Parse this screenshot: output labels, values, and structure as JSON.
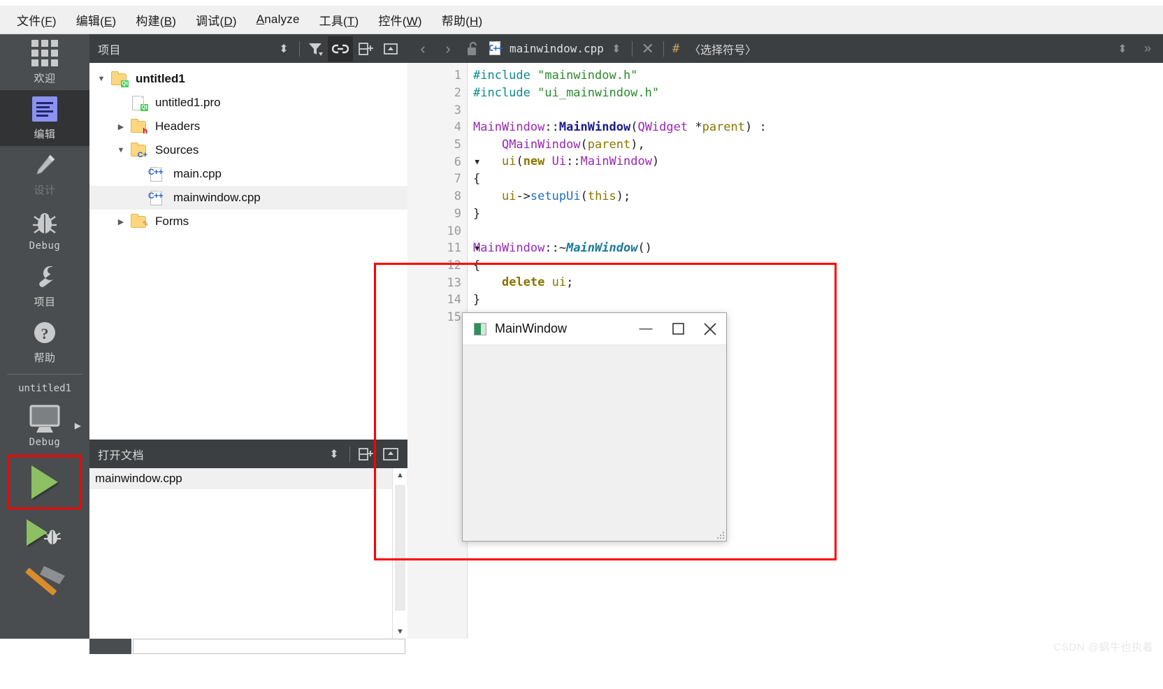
{
  "menubar": {
    "items": [
      {
        "text_before": "文件(",
        "mnemonic": "F",
        "text_after": ")",
        "full": "文件(F)"
      },
      {
        "text_before": "编辑(",
        "mnemonic": "E",
        "text_after": ")",
        "full": "编辑(E)"
      },
      {
        "text_before": "构建(",
        "mnemonic": "B",
        "text_after": ")",
        "full": "构建(B)"
      },
      {
        "text_before": "调试(",
        "mnemonic": "D",
        "text_after": ")",
        "full": "调试(D)"
      },
      {
        "text_before": "",
        "mnemonic": "A",
        "text_after": "nalyze",
        "full": "Analyze"
      },
      {
        "text_before": "工具(",
        "mnemonic": "T",
        "text_after": ")",
        "full": "工具(T)"
      },
      {
        "text_before": "控件(",
        "mnemonic": "W",
        "text_after": ")",
        "full": "控件(W)"
      },
      {
        "text_before": "帮助(",
        "mnemonic": "H",
        "text_after": ")",
        "full": "帮助(H)"
      }
    ]
  },
  "activitybar": {
    "modes": [
      {
        "label": "欢迎",
        "icon": "grid-icon",
        "state": "normal"
      },
      {
        "label": "编辑",
        "icon": "edit-icon",
        "state": "selected"
      },
      {
        "label": "设计",
        "icon": "pencil-icon",
        "state": "disabled"
      },
      {
        "label": "Debug",
        "icon": "bug-icon",
        "state": "normal"
      },
      {
        "label": "项目",
        "icon": "wrench-icon",
        "state": "normal"
      },
      {
        "label": "帮助",
        "icon": "question-icon",
        "state": "normal"
      }
    ],
    "kit": {
      "project_name": "untitled1",
      "build_config": "Debug",
      "icon": "monitor-icon",
      "expand_arrow": "▶"
    },
    "run_button": {
      "name": "run-button",
      "icon": "play-triangle",
      "highlighted": true,
      "highlight_color": "#ff0000"
    },
    "debug_button": {
      "name": "start-debugging-button",
      "icon": "play-with-bug"
    },
    "build_button": {
      "name": "build-button",
      "icon": "hammer"
    }
  },
  "project_dock": {
    "title": "项目",
    "toolbar": [
      {
        "name": "filter-configuration-button",
        "icon": "filter-icon",
        "active": false
      },
      {
        "name": "synchronize-selection-button",
        "icon": "link-icon",
        "active": true
      },
      {
        "name": "split-button",
        "icon": "split-icon",
        "active": false
      },
      {
        "name": "close-sidebar-button",
        "icon": "collapse-icon",
        "active": false
      }
    ],
    "sort_control": "⬍",
    "tree": [
      {
        "label": "untitled1",
        "indent": 0,
        "twisty": "▼",
        "icon": "qt-project-folder",
        "bold": true,
        "selected": false
      },
      {
        "label": "untitled1.pro",
        "indent": 1,
        "twisty": "",
        "icon": "qt-pro-file",
        "bold": false,
        "selected": false
      },
      {
        "label": "Headers",
        "indent": 1,
        "twisty": "▶",
        "icon": "headers-folder",
        "bold": false,
        "selected": false
      },
      {
        "label": "Sources",
        "indent": 1,
        "twisty": "▼",
        "icon": "sources-folder",
        "bold": false,
        "selected": false
      },
      {
        "label": "main.cpp",
        "indent": 2,
        "twisty": "",
        "icon": "cpp-file",
        "bold": false,
        "selected": false
      },
      {
        "label": "mainwindow.cpp",
        "indent": 2,
        "twisty": "",
        "icon": "cpp-file",
        "bold": false,
        "selected": true
      },
      {
        "label": "Forms",
        "indent": 1,
        "twisty": "▶",
        "icon": "forms-folder",
        "bold": false,
        "selected": false
      }
    ]
  },
  "opendoc_dock": {
    "title": "打开文档",
    "sort_control": "⬍",
    "toolbar": [
      {
        "name": "split-button",
        "icon": "split-icon"
      },
      {
        "name": "close-sidebar-button",
        "icon": "collapse-icon"
      }
    ],
    "documents": [
      {
        "label": "mainwindow.cpp",
        "selected": true
      }
    ]
  },
  "editor": {
    "toolbar": {
      "back_icon": "chevron-left-icon",
      "forward_icon": "chevron-right-icon",
      "lock_icon": "unlocked-padlock-icon",
      "file_icon": "cpp-file-icon",
      "filename": "mainwindow.cpp",
      "dropdown_icon": "⬍",
      "close_label": "✕",
      "hash_symbol": "#",
      "symbol_selector": "〈选择符号〉",
      "overflow_icon": "»",
      "overflow_dropdown": "⬍"
    },
    "lines": [
      {
        "num": "1",
        "fold": "",
        "tokens": [
          {
            "t": "#include ",
            "c": "k-pre"
          },
          {
            "t": "\"mainwindow.h\"",
            "c": "k-str"
          }
        ]
      },
      {
        "num": "2",
        "fold": "",
        "tokens": [
          {
            "t": "#include ",
            "c": "k-pre"
          },
          {
            "t": "\"ui_mainwindow.h\"",
            "c": "k-str"
          }
        ]
      },
      {
        "num": "3",
        "fold": "",
        "tokens": []
      },
      {
        "num": "4",
        "fold": "",
        "tokens": [
          {
            "t": "MainWindow",
            "c": "k-cls"
          },
          {
            "t": "::",
            "c": "k-op"
          },
          {
            "t": "MainWindow",
            "c": "k-fn"
          },
          {
            "t": "(",
            "c": "k-op"
          },
          {
            "t": "QWidget",
            "c": "k-cls"
          },
          {
            "t": " *",
            "c": "k-op"
          },
          {
            "t": "parent",
            "c": "k-var"
          },
          {
            "t": ") :",
            "c": "k-op"
          }
        ]
      },
      {
        "num": "5",
        "fold": "",
        "tokens": [
          {
            "t": "    ",
            "c": "k-plain"
          },
          {
            "t": "QMainWindow",
            "c": "k-cls"
          },
          {
            "t": "(",
            "c": "k-op"
          },
          {
            "t": "parent",
            "c": "k-var"
          },
          {
            "t": "),",
            "c": "k-op"
          }
        ]
      },
      {
        "num": "6",
        "fold": "▼",
        "tokens": [
          {
            "t": "    ",
            "c": "k-plain"
          },
          {
            "t": "ui",
            "c": "k-var"
          },
          {
            "t": "(",
            "c": "k-op"
          },
          {
            "t": "new ",
            "c": "k-kw"
          },
          {
            "t": "Ui",
            "c": "k-cls"
          },
          {
            "t": "::",
            "c": "k-op"
          },
          {
            "t": "MainWindow",
            "c": "k-cls"
          },
          {
            "t": ")",
            "c": "k-op"
          }
        ]
      },
      {
        "num": "7",
        "fold": "",
        "tokens": [
          {
            "t": "{",
            "c": "k-op"
          }
        ]
      },
      {
        "num": "8",
        "fold": "",
        "tokens": [
          {
            "t": "    ",
            "c": "k-plain"
          },
          {
            "t": "ui",
            "c": "k-var"
          },
          {
            "t": "->",
            "c": "k-op"
          },
          {
            "t": "setupUi",
            "c": "k-mem"
          },
          {
            "t": "(",
            "c": "k-op"
          },
          {
            "t": "this",
            "c": "k-this"
          },
          {
            "t": ");",
            "c": "k-op"
          }
        ]
      },
      {
        "num": "9",
        "fold": "",
        "tokens": [
          {
            "t": "}",
            "c": "k-op"
          }
        ]
      },
      {
        "num": "10",
        "fold": "",
        "tokens": []
      },
      {
        "num": "11",
        "fold": "▼",
        "tokens": [
          {
            "t": "MainWindow",
            "c": "k-cls"
          },
          {
            "t": "::~",
            "c": "k-op"
          },
          {
            "t": "MainWindow",
            "c": "k-fni"
          },
          {
            "t": "()",
            "c": "k-op"
          }
        ]
      },
      {
        "num": "12",
        "fold": "",
        "tokens": [
          {
            "t": "{",
            "c": "k-op"
          }
        ]
      },
      {
        "num": "13",
        "fold": "",
        "tokens": [
          {
            "t": "    ",
            "c": "k-plain"
          },
          {
            "t": "delete ",
            "c": "k-kw"
          },
          {
            "t": "ui",
            "c": "k-var"
          },
          {
            "t": ";",
            "c": "k-op"
          }
        ]
      },
      {
        "num": "14",
        "fold": "",
        "tokens": [
          {
            "t": "}",
            "c": "k-op"
          }
        ]
      },
      {
        "num": "15",
        "fold": "",
        "tokens": []
      }
    ]
  },
  "popup_window": {
    "title": "MainWindow",
    "icon": "qt-app-icon",
    "minimize_label": "—",
    "maximize_label": "❐",
    "close_label": "✕",
    "resize_grip": "resize-grip"
  },
  "annotation": {
    "color": "#ff0000",
    "shape": "rectangle"
  },
  "watermark": {
    "text": "CSDN @蜗牛也执着"
  }
}
